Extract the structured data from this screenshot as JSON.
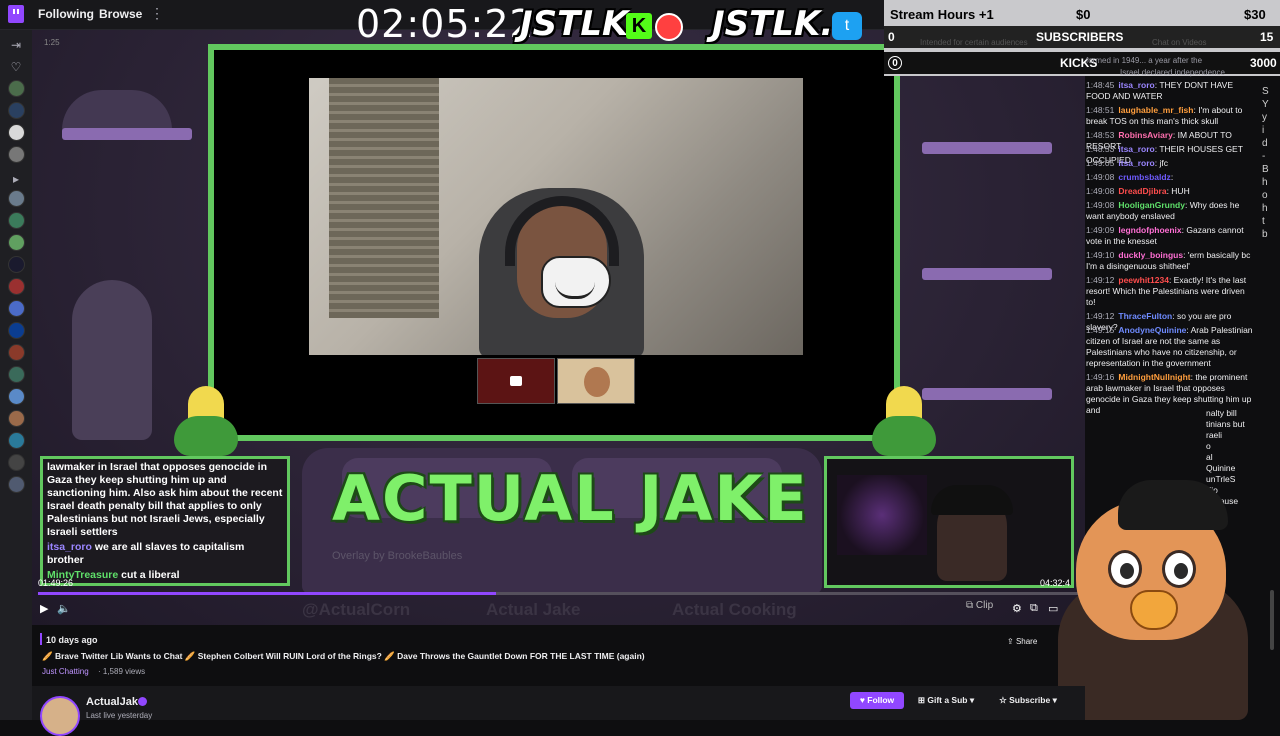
{
  "nav": {
    "following": "Following",
    "browse": "Browse",
    "more": "⋮"
  },
  "overlay": {
    "timer": "02:05:22",
    "logo_left": "JSTLK",
    "kick_letter": "K",
    "logo_right": "JSTLK.",
    "twitter_glyph": "t",
    "goals": {
      "title": "Stream Hours +1",
      "amount_current": "$0",
      "amount_target": "$30",
      "subs_label": "SUBSCRIBERS",
      "subs_current": "0",
      "subs_target": "15",
      "kicks_label": "KICKS",
      "kicks_current": "0",
      "kicks_target": "3000"
    },
    "faint_notes": [
      "Intended for certain audiences",
      "Chat on Videos",
      "formed in 1949... a year after the",
      "Israel declared independence"
    ],
    "brand_title": "ACTUAL JAKE",
    "credit": "Overlay by BrookeBaubles",
    "socials": [
      "@ActualCorn",
      "Actual Jake",
      "Actual Cooking"
    ],
    "stream_chat": [
      "lawmaker in Israel that opposes genocide in",
      "Gaza they keep shutting him up and",
      "sanctioning him. Also ask him about the recent",
      "Israel death penalty bill that applies to only",
      "Palestinians but not Israeli Jews, especially",
      "Israeli settlers"
    ],
    "stream_chat2": {
      "user": "itsa_roro",
      "text": "we are all slaves to capitalism"
    },
    "stream_chat2b": "brother",
    "stream_chat3": {
      "user": "MintyTreasure",
      "text": "cut a liberal"
    }
  },
  "player": {
    "time_current": "01:49:26",
    "time_total": "04:32:4",
    "progress": 0.44,
    "clip_label": "Clip",
    "top_time": "1:25"
  },
  "chat": {
    "messages": [
      {
        "time": "1:48:45",
        "user": "itsa_roro",
        "color": "#9b86ff",
        "text": "THEY DONT HAVE FOOD AND WATER"
      },
      {
        "time": "1:48:51",
        "user": "laughable_mr_fish",
        "color": "#ff9e3d",
        "text": "I'm about to break TOS on this man's thick skull"
      },
      {
        "time": "1:48:53",
        "user": "RobinsAviary",
        "color": "#ff6fae",
        "text": "IM ABOUT TO RESORT"
      },
      {
        "time": "1:48:53",
        "user": "itsa_roro",
        "color": "#9b86ff",
        "text": "THEIR HOUSES GET OCCUPIED"
      },
      {
        "time": "1:49:05",
        "user": "itsa_roro",
        "color": "#9b86ff",
        "text": "jfc"
      },
      {
        "time": "1:49:08",
        "user": "crumbsbaldz",
        "color": "#6f5bff",
        "text": ""
      },
      {
        "time": "1:49:08",
        "user": "DreadDjibra",
        "color": "#ff4d4d",
        "text": "HUH"
      },
      {
        "time": "1:49:08",
        "user": "HooliganGrundy",
        "color": "#5fe06a",
        "text": "Why does he want anybody enslaved"
      },
      {
        "time": "1:49:09",
        "user": "legndofphoenix",
        "color": "#ff6fd4",
        "text": "Gazans cannot vote in the knesset"
      },
      {
        "time": "1:49:10",
        "user": "duckly_boingus",
        "color": "#ff6fd4",
        "text": "'erm basically bc I'm a disingenuous shitheel'"
      },
      {
        "time": "1:49:12",
        "user": "peewhit1234",
        "color": "#ff4d4d",
        "text": "Exactly! It's the last resort! Which the Palestinians were driven to!"
      },
      {
        "time": "1:49:12",
        "user": "ThraceFulton",
        "color": "#6f8bff",
        "text": "so you are pro slavery?"
      },
      {
        "time": "1:49:15",
        "user": "AnodyneQuinine",
        "color": "#6f8bff",
        "text": "Arab Palestinian citizen of Israel are not the same as Palestinians who have no citizenship, or representation in the government"
      },
      {
        "time": "1:49:16",
        "user": "MidnightNullnight",
        "color": "#ff9e3d",
        "text": "the prominent arab lawmaker in Israel that opposes genocide in Gaza they keep shutting him up and"
      }
    ],
    "side_text": [
      "S",
      "Y",
      "y",
      "i",
      "d",
      "",
      "-",
      "B",
      "h",
      "o",
      "h",
      "t",
      "b"
    ],
    "partial_lines": [
      "nalty bill",
      "tinians but",
      "raeli",
      "o",
      "al",
      "Quinine",
      "unTrleS",
      "Zio",
      "because"
    ]
  },
  "below": {
    "date": "10 days ago",
    "title": "🥖 Brave Twitter Lib Wants to Chat 🥖 Stephen Colbert Will RUIN Lord of the Rings? 🥖 Dave Throws the Gauntlet Down FOR THE LAST TIME (again)",
    "category": "Just Chatting",
    "views": "· 1,589 views",
    "share": "Share",
    "channel": "ActualJake",
    "last_live": "Last live yesterday",
    "follow": "Follow",
    "gift": "Gift a Sub",
    "subscribe": "Subscribe"
  },
  "colors": {
    "accent": "#9147ff",
    "frame_green": "#62c85f",
    "brand_green": "#7ff06a"
  }
}
